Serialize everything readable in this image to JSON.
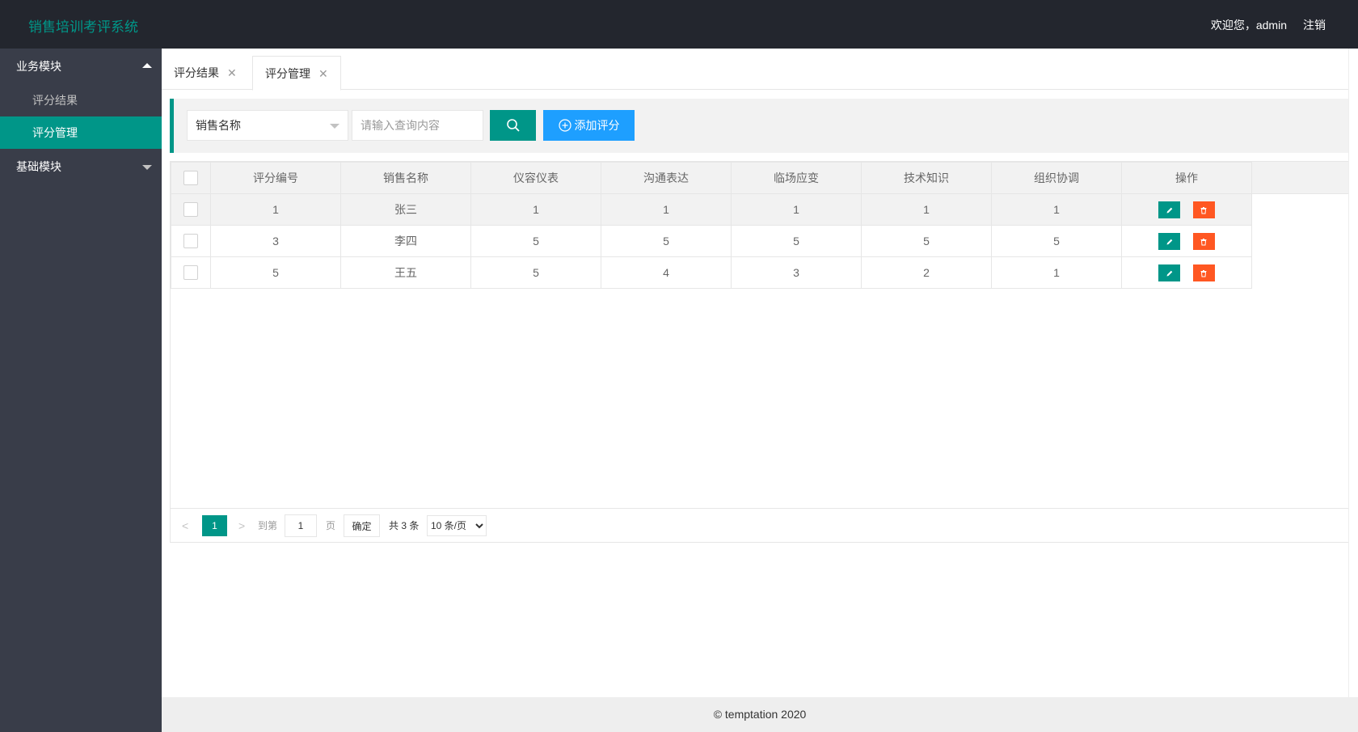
{
  "app": {
    "title": "销售培训考评系统"
  },
  "header": {
    "welcome": "欢迎您，admin",
    "logout": "注销"
  },
  "sidebar": {
    "groups": [
      {
        "label": "业务模块",
        "items": [
          {
            "label": "评分结果"
          },
          {
            "label": "评分管理"
          }
        ]
      },
      {
        "label": "基础模块"
      }
    ]
  },
  "tabs": [
    {
      "label": "评分结果"
    },
    {
      "label": "评分管理"
    }
  ],
  "search": {
    "field_selected": "销售名称",
    "placeholder": "请输入查询内容",
    "add_label": "添加评分"
  },
  "table": {
    "columns": [
      "评分编号",
      "销售名称",
      "仪容仪表",
      "沟通表达",
      "临场应变",
      "技术知识",
      "组织协调",
      "操作"
    ],
    "rows": [
      [
        "1",
        "张三",
        "1",
        "1",
        "1",
        "1",
        "1"
      ],
      [
        "3",
        "李四",
        "5",
        "5",
        "5",
        "5",
        "5"
      ],
      [
        "5",
        "王五",
        "5",
        "4",
        "3",
        "2",
        "1"
      ]
    ]
  },
  "pager": {
    "current_page": "1",
    "goto_label": "到第",
    "goto_value": "1",
    "page_unit": "页",
    "confirm": "确定",
    "total": "共 3 条",
    "page_size": "10 条/页"
  },
  "footer": {
    "text": "© temptation 2020"
  },
  "colors": {
    "primary": "#009688",
    "blue": "#1e9fff",
    "danger": "#ff5722",
    "dark": "#23262e",
    "sidebar": "#393d49"
  }
}
